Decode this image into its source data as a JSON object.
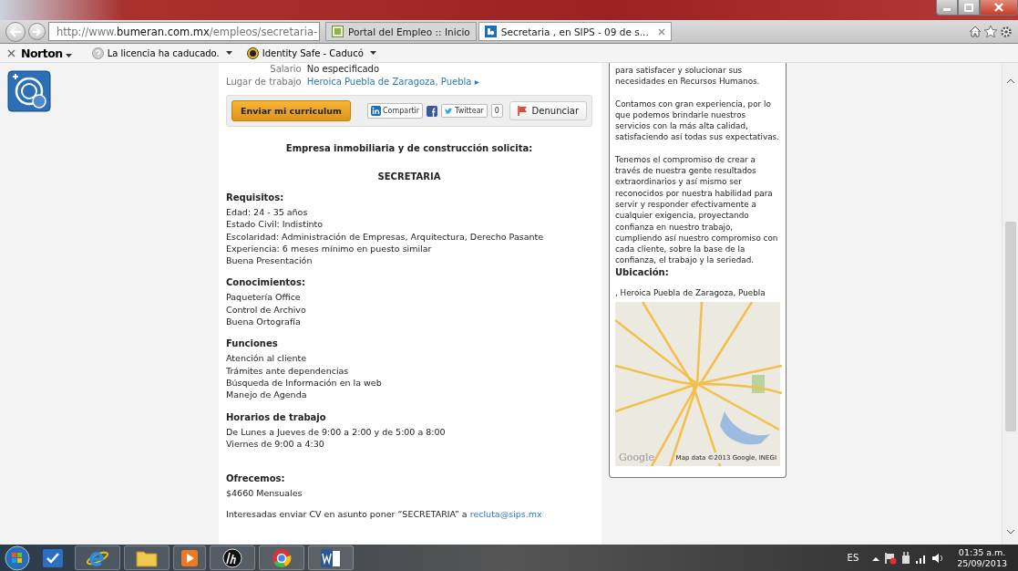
{
  "browser": {
    "address": {
      "prefix": "http://www.",
      "host": "bumeran.com.mx",
      "path": "/empleos/secretaria-"
    },
    "tabs": [
      {
        "label": "Portal del Empleo :: Inicio",
        "selected": false
      },
      {
        "label": "Secretaria , en SIPS - 09 de s...",
        "selected": true
      }
    ]
  },
  "toolbar": {
    "brand": "Norton",
    "items": [
      "La licencia ha caducado.",
      "Identity Safe - Caducó"
    ]
  },
  "job": {
    "details": [
      {
        "label": "Salario",
        "value": "No especificado",
        "kind": "text"
      },
      {
        "label": "Lugar de trabajo",
        "value": "Heroica Puebla de Zaragoza, Puebla ▸",
        "kind": "link"
      }
    ],
    "actions": {
      "apply": "Enviar mi curriculum",
      "share": "Compartir",
      "tweet": "Twittear",
      "count": "0",
      "report": "Denunciar"
    },
    "intro": "Empresa inmobiliaria y de construcción solicita:",
    "title": "SECRETARIA",
    "sections": [
      {
        "heading": "Requisitos:",
        "lines": [
          "Edad: 24 - 35 años",
          "Estado Civil: Indistinto",
          "Escolaridad: Administración de Empresas, Arquitectura, Derecho Pasante",
          "Experiencia: 6 meses mínimo en puesto similar",
          "Buena Presentación"
        ]
      },
      {
        "heading": "Conocimientos:",
        "lines": [
          "Paquetería Office",
          "Control de Archivo",
          "Buena Ortografía"
        ]
      },
      {
        "heading": "Funciones",
        "lines": [
          "Atención al cliente",
          "Trámites ante dependencias",
          "Búsqueda de Información en la web",
          "Manejo de Agenda"
        ]
      },
      {
        "heading": "Horarios de trabajo",
        "lines": [
          "De Lunes  a Jueves de 9:00 a 2:00 y de 5:00 a 8:00",
          "Viernes de 9:00 a 4:30"
        ]
      },
      {
        "heading": "Ofrecemos:",
        "lines": [
          "$4660 Mensuales"
        ]
      }
    ],
    "contact": {
      "text": "Interesadas enviar CV en asunto poner “SECRETARIA” a ",
      "email": "recluta@sips.mx"
    }
  },
  "sidebar": {
    "paragraphs": [
      "para satisfacer y solucionar sus necesidades en Recursos Humanos.",
      "Contamos con gran experiencia, por lo que podemos brindarle nuestros servicios con la más alta calidad, satisfaciendo así todas sus expectativas.",
      "Tenemos el compromiso de crear a través de nuestra gente resultados extraordinarios y así mismo ser reconocidos por nuestra habilidad para servir y responder efectivamente a cualquier exigencia, proyectando confianza en nuestro trabajo, cumpliendo así nuestro compromiso con cada cliente, sobre la base de la confianza, el trabajo y la seriedad."
    ],
    "heading": "Ubicación:",
    "location": ", Heroica Puebla de Zaragoza, Puebla",
    "map_logo": "Google",
    "map_attribution": "Map data ©2013 Google, INEGI"
  },
  "taskbar": {
    "language": "ES",
    "time": "01:35 a.m.",
    "date": "25/09/2013"
  }
}
